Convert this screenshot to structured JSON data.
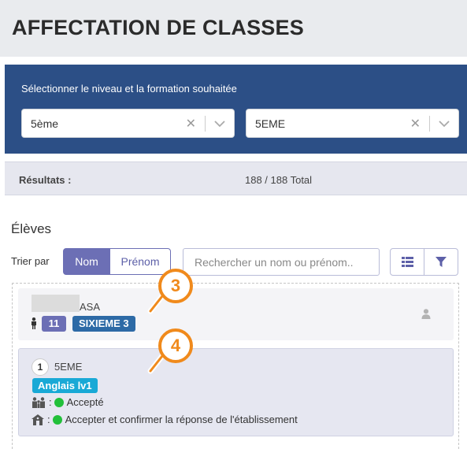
{
  "page": {
    "title": "AFFECTATION DE CLASSES"
  },
  "filters": {
    "heading": "Sélectionner le niveau et la formation souhaitée",
    "niveau": {
      "value": "5ème"
    },
    "formation": {
      "value": "5EME"
    },
    "clear_symbol": "✕"
  },
  "results": {
    "label": "Résultats :",
    "count": "188 / 188 Total"
  },
  "students_section": {
    "title": "Élèves",
    "sort_label": "Trier par",
    "sort_options": [
      "Nom",
      "Prénom"
    ],
    "search_placeholder": "Rechercher un nom ou prénom.."
  },
  "student": {
    "name_suffix": "ASA",
    "number": "11",
    "current_class": "SIXIEME 3"
  },
  "choice": {
    "rank": "1",
    "class": "5EME",
    "option": "Anglais lv1",
    "family_status": ": ",
    "family_status_text": "Accepté",
    "school_status": ": ",
    "school_status_text": "Accepter et confirmer la réponse de l'établissement"
  },
  "callouts": [
    "3",
    "4"
  ],
  "colors": {
    "panel": "#2c4f86",
    "accent": "#6c6fb5",
    "class_badge": "#2d6aa6",
    "option_badge": "#19a9d6",
    "status_ok": "#22c03a",
    "callout": "#f08a1c"
  }
}
